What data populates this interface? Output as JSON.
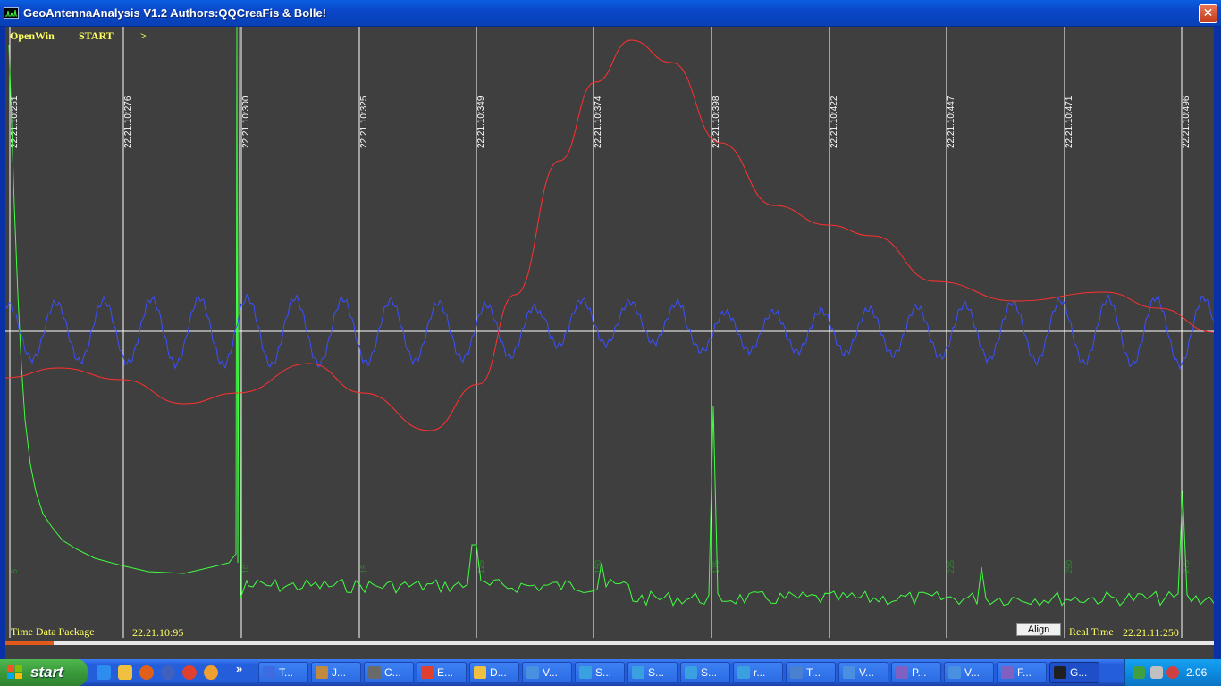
{
  "window": {
    "title": "GeoAntennaAnalysis V1.2 Authors:QQCreaFis & Bolle!",
    "close_glyph": "✕"
  },
  "menu": {
    "open_label": "OpenWin",
    "start_label": "START",
    "next_label": ">"
  },
  "plot": {
    "timestamps": [
      "22.21.10:251",
      "22.21.10:276",
      "22.21.10:300",
      "22.21.10:325",
      "22.21.10:349",
      "22.21.10:374",
      "22.21.10:398",
      "22.21.10:422",
      "22.21.10:447",
      "22.21.10:471",
      "22.21.10:496"
    ],
    "bottom_ticks": [
      "5",
      "",
      "10",
      "15",
      "125",
      "150",
      "175",
      "",
      "225",
      "250",
      "275"
    ],
    "colors": {
      "background": "#3f3f3f",
      "gridline": "#ffffff",
      "blue_series": "#3a4fff",
      "red_series": "#ff3030",
      "green_series": "#40ff40",
      "label_text": "#ffff60"
    }
  },
  "footer": {
    "time_label": "Time Data Package",
    "time_value": "22.21.10:95",
    "align_label": "Align",
    "realtime_label": "Real Time",
    "realtime_value": "22.21.11:250",
    "scroll_fraction": 0.04
  },
  "taskbar": {
    "start_label": "start",
    "chevron": "»",
    "tasks": [
      "T...",
      "J...",
      "C...",
      "E...",
      "D...",
      "V...",
      "S...",
      "S...",
      "S...",
      "r...",
      "T...",
      "V...",
      "P...",
      "V...",
      "F...",
      "G..."
    ],
    "clock": "2.06"
  }
}
